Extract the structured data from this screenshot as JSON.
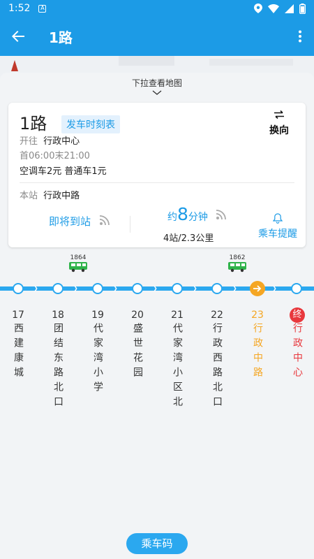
{
  "status_bar": {
    "time": "1:52",
    "sim_label": "A"
  },
  "header": {
    "title": "1路"
  },
  "map": {
    "pull_hint": "下拉查看地图"
  },
  "route_card": {
    "line_name": "1路",
    "timetable_button": "发车时刻表",
    "switch_label": "换向",
    "direction_prefix": "开往",
    "direction": "行政中心",
    "first_bus": "首06:00",
    "last_bus": "末21:00",
    "fare": "空调车2元 普通车1元",
    "current_stop_prefix": "本站",
    "current_stop": "行政中路",
    "arriving_label": "即将到站",
    "eta_prefix": "约",
    "eta_minutes": "8",
    "eta_suffix": "分钟",
    "eta_distance": "4站/2.3公里",
    "remind_label": "乘车提醒"
  },
  "buses": [
    {
      "plate": "1864"
    },
    {
      "plate": "1862"
    }
  ],
  "stops": [
    {
      "no": "17",
      "name": "西建康城",
      "state": "normal"
    },
    {
      "no": "18",
      "name": "团结东路北口",
      "state": "normal"
    },
    {
      "no": "19",
      "name": "代家湾小学",
      "state": "normal"
    },
    {
      "no": "20",
      "name": "盛世花园",
      "state": "normal"
    },
    {
      "no": "21",
      "name": "代家湾小区北",
      "state": "normal"
    },
    {
      "no": "22",
      "name": "行政西路北口",
      "state": "normal"
    },
    {
      "no": "23",
      "name": "行政中路",
      "state": "current"
    },
    {
      "no": "终",
      "name": "行政中心",
      "state": "terminal"
    }
  ],
  "bottom": {
    "ride_code_button": "乘车码"
  },
  "colors": {
    "primary": "#1c9be6",
    "track": "#2ba8ef",
    "current": "#f5a623",
    "terminal": "#e8383d",
    "bus_green": "#2fb34a"
  }
}
